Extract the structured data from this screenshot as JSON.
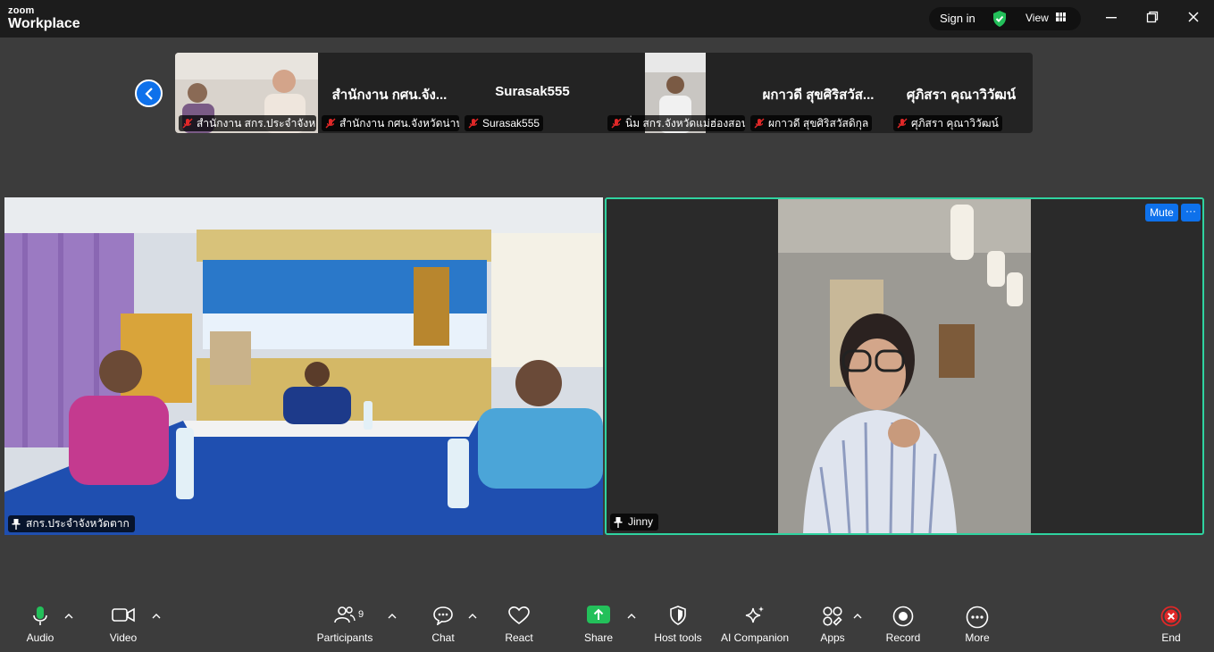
{
  "app": {
    "logo_top": "zoom",
    "logo_bottom": "Workplace"
  },
  "titlebar": {
    "sign_in": "Sign in",
    "view": "View"
  },
  "filmstrip": {
    "tiles": [
      {
        "name": "",
        "label": "สำนักงาน สกร.ประจำจังห..."
      },
      {
        "name": "สำนักงาน กศน.จัง...",
        "label": "สำนักงาน กศน.จังหวัดน่าน"
      },
      {
        "name": "Surasak555",
        "label": "Surasak555"
      },
      {
        "name": "",
        "label": "นิ่ม สกร.จังหวัดแม่ฮ่องสอน"
      },
      {
        "name": "ผกาวดี สุขศิริสวัส...",
        "label": "ผกาวดี สุขศิริสวัสดิกุล"
      },
      {
        "name": "ศุภิสรา คุณาวิวัฒน์",
        "label": "ศุภิสรา คุณาวิวัฒน์"
      }
    ]
  },
  "videos": {
    "left": {
      "label": "สกร.ประจำจังหวัดตาก"
    },
    "right": {
      "label": "Jinny",
      "mute": "Mute",
      "more": "···"
    }
  },
  "toolbar": {
    "audio": "Audio",
    "video": "Video",
    "participants": "Participants",
    "participants_count": "9",
    "chat": "Chat",
    "react": "React",
    "share": "Share",
    "host_tools": "Host tools",
    "ai_companion": "AI Companion",
    "apps": "Apps",
    "record": "Record",
    "more": "More",
    "end": "End"
  },
  "colors": {
    "accent": "#0e71eb",
    "active_speaker": "#2fd3a0",
    "share": "#23c05a",
    "end": "#e02828"
  }
}
